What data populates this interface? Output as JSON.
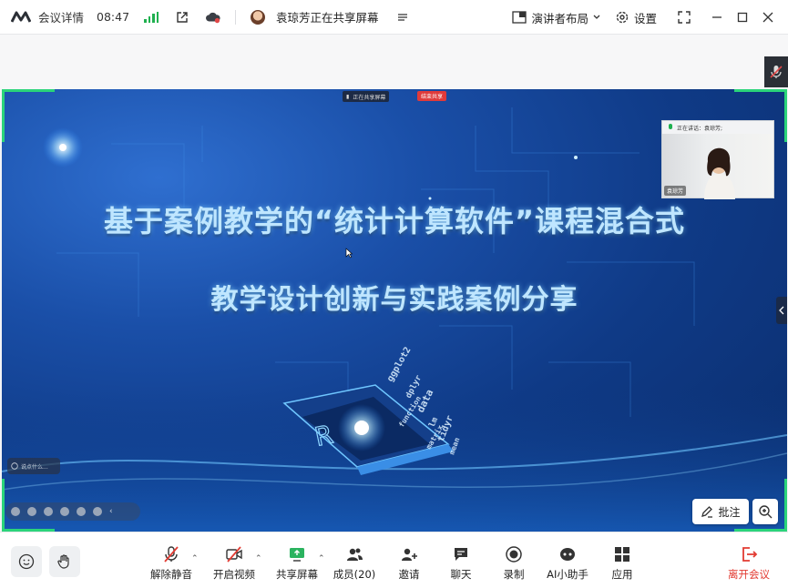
{
  "titlebar": {
    "meeting_details": "会议详情",
    "time": "08:47",
    "sharing_status": "袁琼芳正在共享屏幕",
    "layout_label": "演讲者布局",
    "settings_label": "设置"
  },
  "shared_screen": {
    "share_bar_text": "正在共享屏幕",
    "stop_share_label": "结束共享",
    "slide_title_line1": "基于案例教学的“统计计算软件”课程混合式",
    "slide_title_line2": "教学设计创新与实践案例分享",
    "chat_placeholder": "说点什么...",
    "annotate_label": "批注"
  },
  "video_tile": {
    "speaking_label": "正在讲话：袁琼芳;",
    "participant_name": "袁琼芳"
  },
  "bottombar": {
    "unmute": "解除静音",
    "start_video": "开启视频",
    "share_screen": "共享屏幕",
    "members": "成员(20)",
    "invite": "邀请",
    "chat": "聊天",
    "record": "录制",
    "ai_assistant": "AI小助手",
    "apps": "应用",
    "leave": "离开会议"
  },
  "colors": {
    "accent_green": "#2bd47a",
    "leave_red": "#e23b32",
    "signal_green": "#1fb04f"
  }
}
